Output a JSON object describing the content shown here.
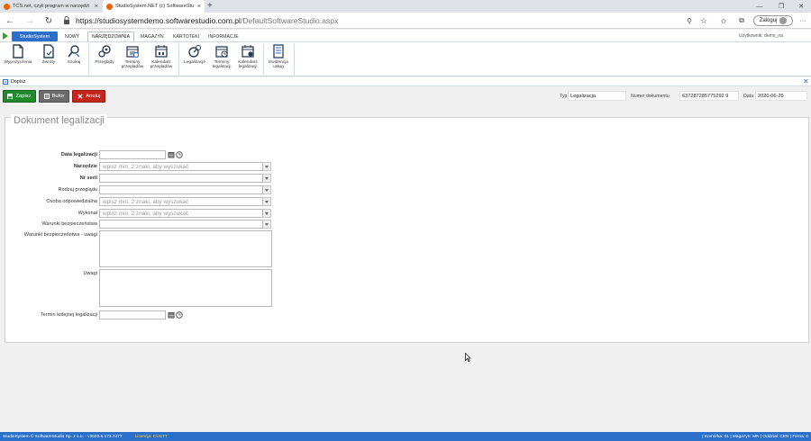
{
  "browser": {
    "tabs": [
      {
        "title": "TCS.net, czyli program w narzędzi",
        "active": false
      },
      {
        "title": "StudioSystem.NET (c) SoftwareStu",
        "active": true
      }
    ],
    "url_host": "https://studiosystemdemo.softwarestudio.com.pl",
    "url_path": "/DefaultSoftwareStudio.aspx",
    "login_label": "Zaloguj",
    "new_tab_glyph": "+",
    "menu_glyph": "···"
  },
  "app": {
    "app_button": "StudioSystem",
    "ribbon_tabs": [
      "NOWY",
      "NARZĘDZOWNIA",
      "MAGAZYN",
      "KARTOTEKI",
      "INFORMACJE"
    ],
    "active_tab": "NARZĘDZOWNIA",
    "user_info": "Użytkownik: demo_na",
    "ribbon_buttons": [
      {
        "label": "Wypożyczenia",
        "icon": "document-icon"
      },
      {
        "label": "Zwroty",
        "icon": "document-return-icon"
      },
      {
        "label": "Szukaj",
        "icon": "search-tool-icon"
      },
      {
        "label": "Przeglądy",
        "icon": "gears-icon"
      },
      {
        "label": "Terminy przeglądów",
        "icon": "calendar-list-icon"
      },
      {
        "label": "Kalendarz przeglądów",
        "icon": "calendar-icon"
      },
      {
        "label": "Legalizacje",
        "icon": "gauge-icon"
      },
      {
        "label": "Terminy legalizacji",
        "icon": "calendar-check-icon"
      },
      {
        "label": "Kalendarz legalizacji",
        "icon": "calendar-gear-icon"
      },
      {
        "label": "Ewidencja usług",
        "icon": "ledger-icon"
      }
    ]
  },
  "subheader": {
    "title": "Dopisz"
  },
  "actions": {
    "save": "Zapisz",
    "buffer": "Bufor",
    "cancel": "Anuluj"
  },
  "doc_meta": {
    "type_label": "Typ",
    "type_value": "Legalizacja",
    "number_label": "Numer dokumentu",
    "number_value": "637287285775292 9",
    "date_label": "Data",
    "date_value": "2020-06-26"
  },
  "form": {
    "legend": "Dokument legalizacji",
    "fields": {
      "data_legalizacji": {
        "label": "Data legalizacji",
        "value": ""
      },
      "narzedzie": {
        "label": "Narzędzie",
        "placeholder": "wpisz min. 2 znaki, aby wyszukać"
      },
      "nr_seri": {
        "label": "Nr serii",
        "value": ""
      },
      "rodzaj_przegladu": {
        "label": "Rodzaj przeglądu",
        "value": ""
      },
      "osoba_odpowiedzialna": {
        "label": "Osoba odpowiedzialna",
        "placeholder": "wpisz min. 2 znaki, aby wyszukać"
      },
      "wykonal": {
        "label": "Wykonał",
        "placeholder": "wpisz min. 2 znaki, aby wyszukać"
      },
      "warunki_bezpieczenstwa": {
        "label": "Warunki bezpieczeństwa",
        "value": ""
      },
      "warunki_uwagi": {
        "label": "Warunki bezpieczeństwa - uwagi",
        "value": ""
      },
      "uwagi": {
        "label": "Uwagi",
        "value": ""
      },
      "termin_kolejnej": {
        "label": "Termin kolejnej legalizacji",
        "value": ""
      }
    }
  },
  "status": {
    "left": "StudioSystem © SoftwareStudio Sp. z o.o. - v2020.6.173.7477",
    "license": "Licencja: CUSTT",
    "right": "| Komórka: 01 | Magazyn: MN | Oddział: CEN | Firma: 0"
  },
  "colors": {
    "brand_blue": "#2a6fc9",
    "save_green": "#1f8a2b",
    "buffer_grey": "#6b6b6b",
    "cancel_red": "#c4261d"
  }
}
